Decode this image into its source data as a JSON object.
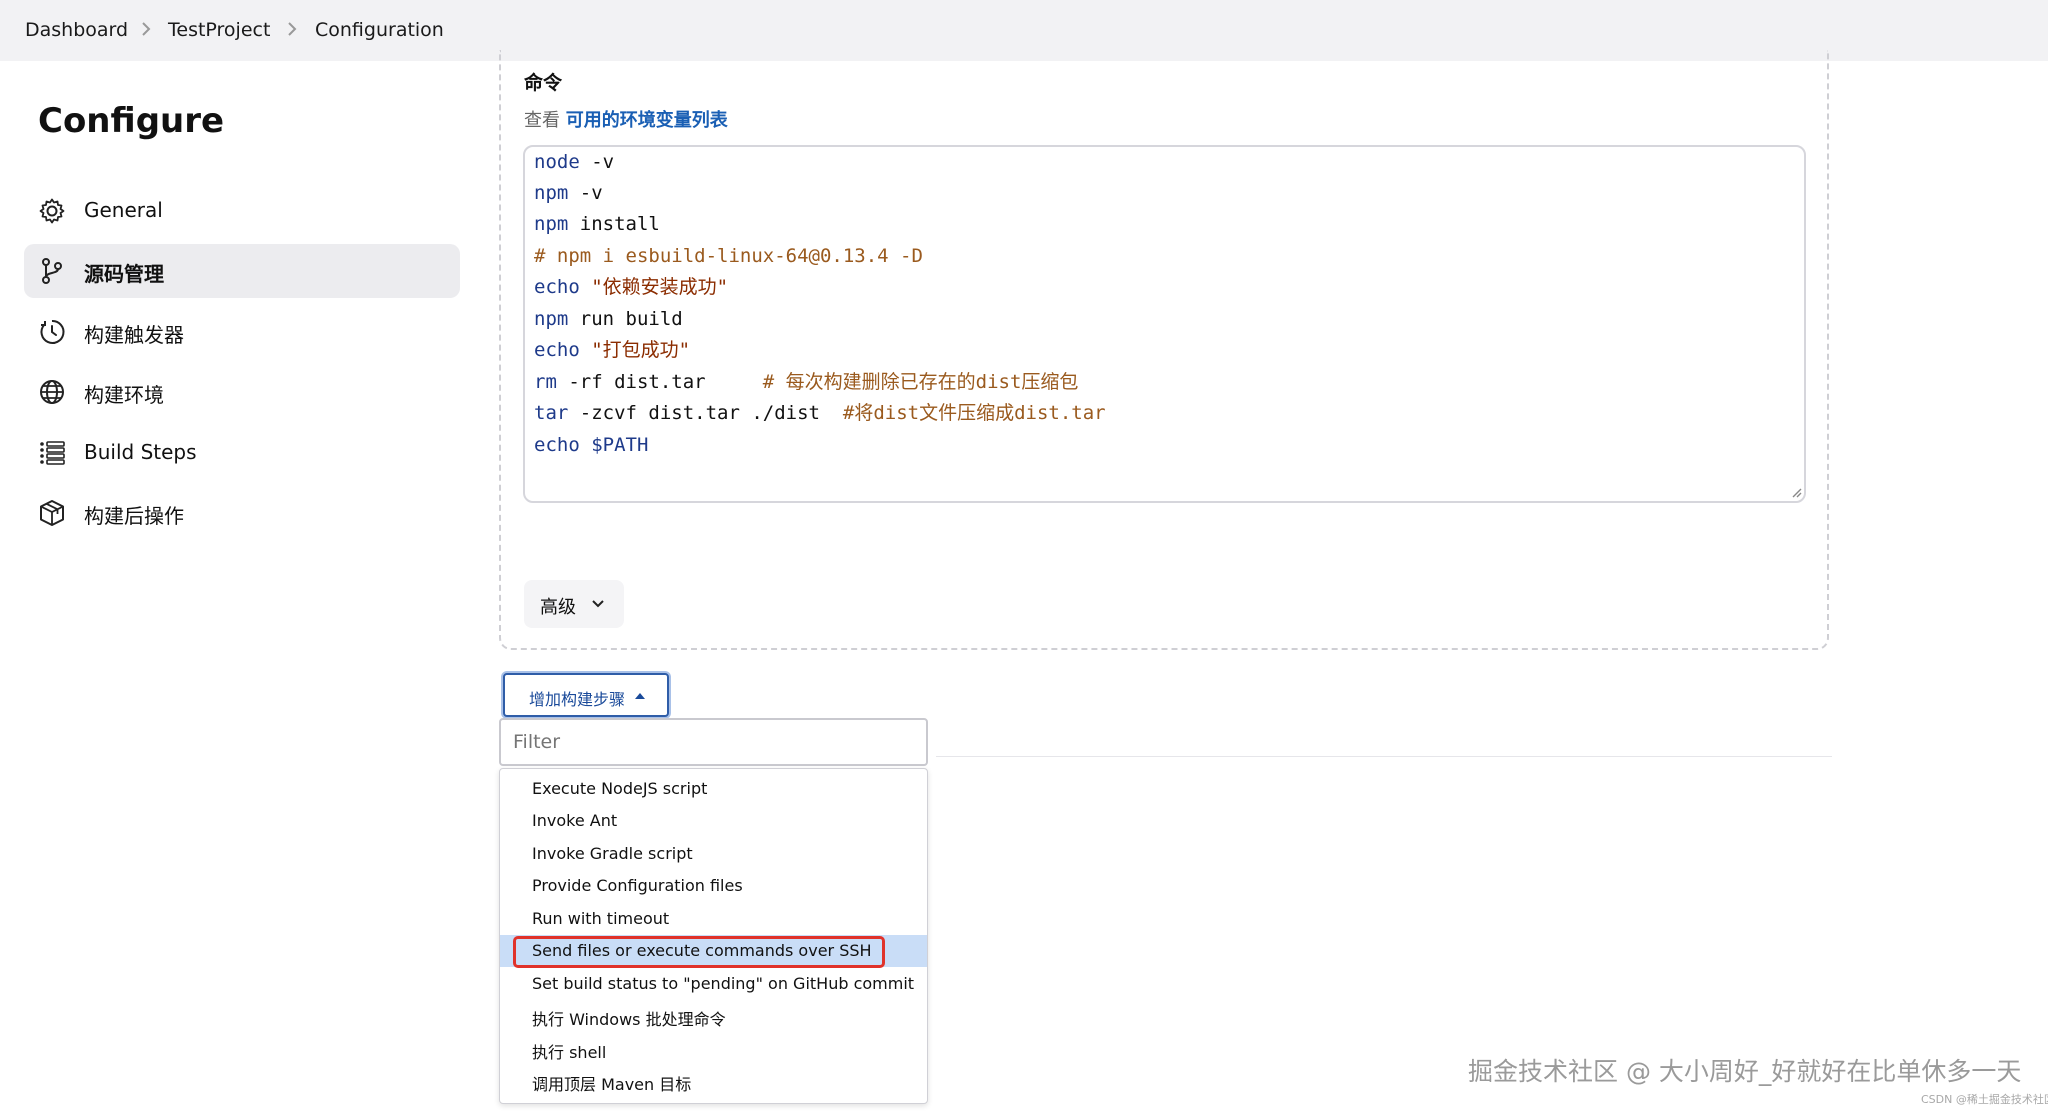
{
  "breadcrumb": {
    "items": [
      "Dashboard",
      "TestProject",
      "Configuration"
    ]
  },
  "page_title": "Configure",
  "sidebar": {
    "items": [
      {
        "label": "General",
        "icon": "gear-icon",
        "active": false
      },
      {
        "label": "源码管理",
        "icon": "branch-icon",
        "active": true
      },
      {
        "label": "构建触发器",
        "icon": "clock-icon",
        "active": false
      },
      {
        "label": "构建环境",
        "icon": "globe-icon",
        "active": false
      },
      {
        "label": "Build Steps",
        "icon": "list-icon",
        "active": false
      },
      {
        "label": "构建后操作",
        "icon": "package-icon",
        "active": false
      }
    ]
  },
  "command": {
    "label": "命令",
    "helper_prefix": "查看",
    "helper_link": "可用的环境变量列表",
    "lines": {
      "l1": {
        "cmd": "node",
        "rest": " -v"
      },
      "l2": {
        "cmd": "npm",
        "rest": " -v"
      },
      "l3": {
        "cmd": "npm",
        "rest": " install"
      },
      "l4": {
        "comment": "# npm i esbuild-linux-64@0.13.4 -D"
      },
      "l5": {
        "cmd": "echo",
        "str": "\"依赖安装成功\""
      },
      "l6": {
        "cmd": "npm",
        "rest": " run build"
      },
      "l7": {
        "cmd": "echo",
        "str": "\"打包成功\""
      },
      "l8": {
        "cmd": "rm",
        "rest": " -rf dist.tar     ",
        "comment": "# 每次构建删除已存在的dist压缩包"
      },
      "l9": {
        "cmd": "tar",
        "rest": " -zcvf dist.tar ./dist  ",
        "comment": "#将dist文件压缩成dist.tar"
      },
      "l10": {
        "cmd": "echo",
        "var": "$PATH"
      }
    }
  },
  "advanced_button": {
    "label": "高级"
  },
  "add_build_step": {
    "label": "增加构建步骤"
  },
  "filter": {
    "placeholder": "Filter",
    "value": ""
  },
  "dropdown": {
    "items": [
      "Execute NodeJS script",
      "Invoke Ant",
      "Invoke Gradle script",
      "Provide Configuration files",
      "Run with timeout",
      "Send files or execute commands over SSH",
      "Set build status to \"pending\" on GitHub commit",
      "执行 Windows 批处理命令",
      "执行 shell",
      "调用顶层 Maven 目标"
    ],
    "selected_index": 5
  },
  "watermark": {
    "text": "掘金技术社区 @ 大小周好_好就好在比单休多一天",
    "small": "CSDN @稀土掘金技术社区"
  },
  "colors": {
    "link": "#1a5fb4",
    "selection": "#c9ddf7",
    "highlight_border": "#e0322a",
    "button_border": "#2f5da8"
  }
}
